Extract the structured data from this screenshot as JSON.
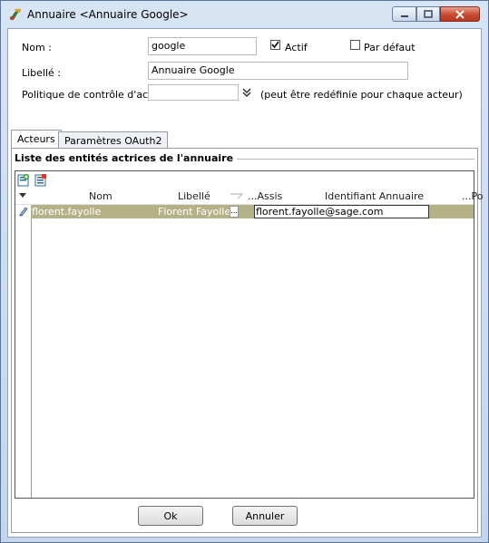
{
  "window": {
    "title": "Annuaire <Annuaire Google>"
  },
  "form": {
    "nom_label": "Nom :",
    "nom_value": "google",
    "actif_label": "Actif",
    "actif_checked": true,
    "par_defaut_label": "Par défaut",
    "par_defaut_checked": false,
    "libelle_label": "Libellé :",
    "libelle_value": "Annuaire Google",
    "politique_label": "Politique de contrôle d'accè",
    "politique_value": "",
    "politique_hint": "(peut être redéfinie pour chaque acteur)"
  },
  "tabs": [
    {
      "label": "Acteurs",
      "active": true
    },
    {
      "label": "Paramètres OAuth2",
      "active": false
    }
  ],
  "section": {
    "title": "Liste des entités actrices de l'annuaire"
  },
  "grid": {
    "columns": [
      "Nom",
      "Libellé",
      "...Assis",
      "Identifiant Annuaire",
      "...Po"
    ],
    "rows": [
      {
        "nom": "florent.fayolle",
        "libelle": "Florent Fayolle",
        "assis": "...",
        "identifiant": "florent.fayolle@sage.com",
        "selected": true
      }
    ]
  },
  "buttons": {
    "ok": "Ok",
    "cancel": "Annuler"
  },
  "colors": {
    "selection": "#b4b187",
    "close_button": "#c74a30"
  }
}
